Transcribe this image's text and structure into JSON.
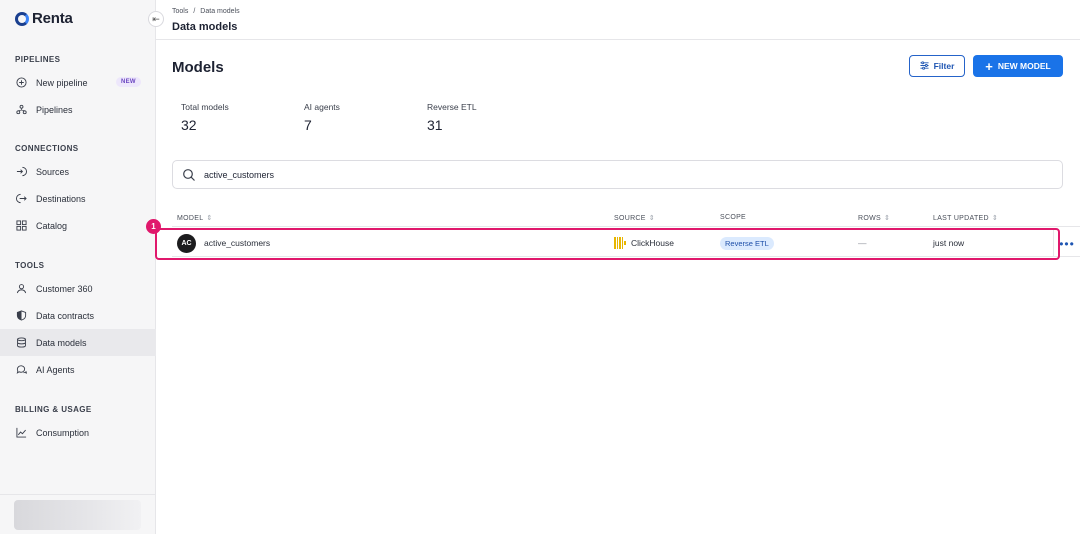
{
  "brand": {
    "name": "Renta"
  },
  "sidebar": {
    "collapse_icon": "collapse-left-icon",
    "sections": [
      {
        "title": "PIPELINES",
        "items": [
          {
            "label": "New pipeline",
            "icon": "plus-circle-icon",
            "badge": "NEW"
          },
          {
            "label": "Pipelines",
            "icon": "pipeline-icon"
          }
        ]
      },
      {
        "title": "CONNECTIONS",
        "items": [
          {
            "label": "Sources",
            "icon": "source-icon"
          },
          {
            "label": "Destinations",
            "icon": "destination-icon"
          },
          {
            "label": "Catalog",
            "icon": "catalog-icon"
          }
        ]
      },
      {
        "title": "TOOLS",
        "items": [
          {
            "label": "Customer 360",
            "icon": "user-icon"
          },
          {
            "label": "Data contracts",
            "icon": "shield-icon"
          },
          {
            "label": "Data models",
            "icon": "database-icon",
            "active": true
          },
          {
            "label": "AI Agents",
            "icon": "chat-icon"
          }
        ]
      },
      {
        "title": "BILLING & USAGE",
        "items": [
          {
            "label": "Consumption",
            "icon": "chart-icon"
          }
        ]
      }
    ]
  },
  "header": {
    "breadcrumb": [
      "Tools",
      "/",
      "Data models"
    ],
    "title": "Data models"
  },
  "main": {
    "heading": "Models",
    "filter_label": "Filter",
    "new_model_label": "NEW MODEL",
    "stats": [
      {
        "label": "Total models",
        "value": "32"
      },
      {
        "label": "AI agents",
        "value": "7"
      },
      {
        "label": "Reverse ETL",
        "value": "31"
      }
    ],
    "search": {
      "value": "active_customers",
      "placeholder": ""
    },
    "table": {
      "columns": [
        "MODEL",
        "SOURCE",
        "SCOPE",
        "ROWS",
        "LAST UPDATED"
      ],
      "rows": [
        {
          "avatar": "AC",
          "model": "active_customers",
          "source": "ClickHouse",
          "scope": "Reverse ETL",
          "rows": "—",
          "last_updated": "just now"
        }
      ]
    },
    "annotation_marker": "1"
  },
  "colors": {
    "primary": "#1a73e8",
    "highlight": "#e0186c",
    "scope_chip_bg": "#dbeafe",
    "clickhouse": "#e8b600"
  }
}
